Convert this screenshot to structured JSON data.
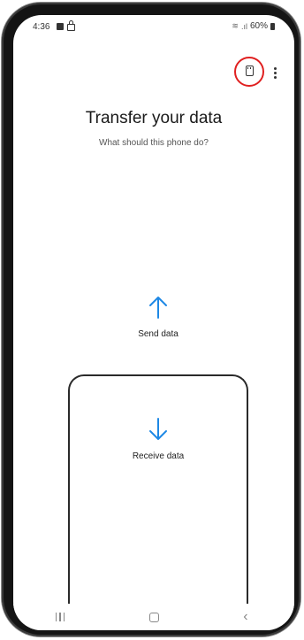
{
  "status_bar": {
    "time": "4:36",
    "battery": "60%"
  },
  "header": {
    "title": "Transfer your data",
    "subtitle": "What should this phone do?"
  },
  "options": {
    "send_label": "Send data",
    "receive_label": "Receive data"
  },
  "icons": {
    "sd_card": "sd-card-icon",
    "more": "more-options-icon",
    "send": "arrow-up-icon",
    "receive": "arrow-down-icon"
  },
  "colors": {
    "accent": "#1e88e5",
    "highlight": "#e02020",
    "text": "#1a1a1a"
  }
}
